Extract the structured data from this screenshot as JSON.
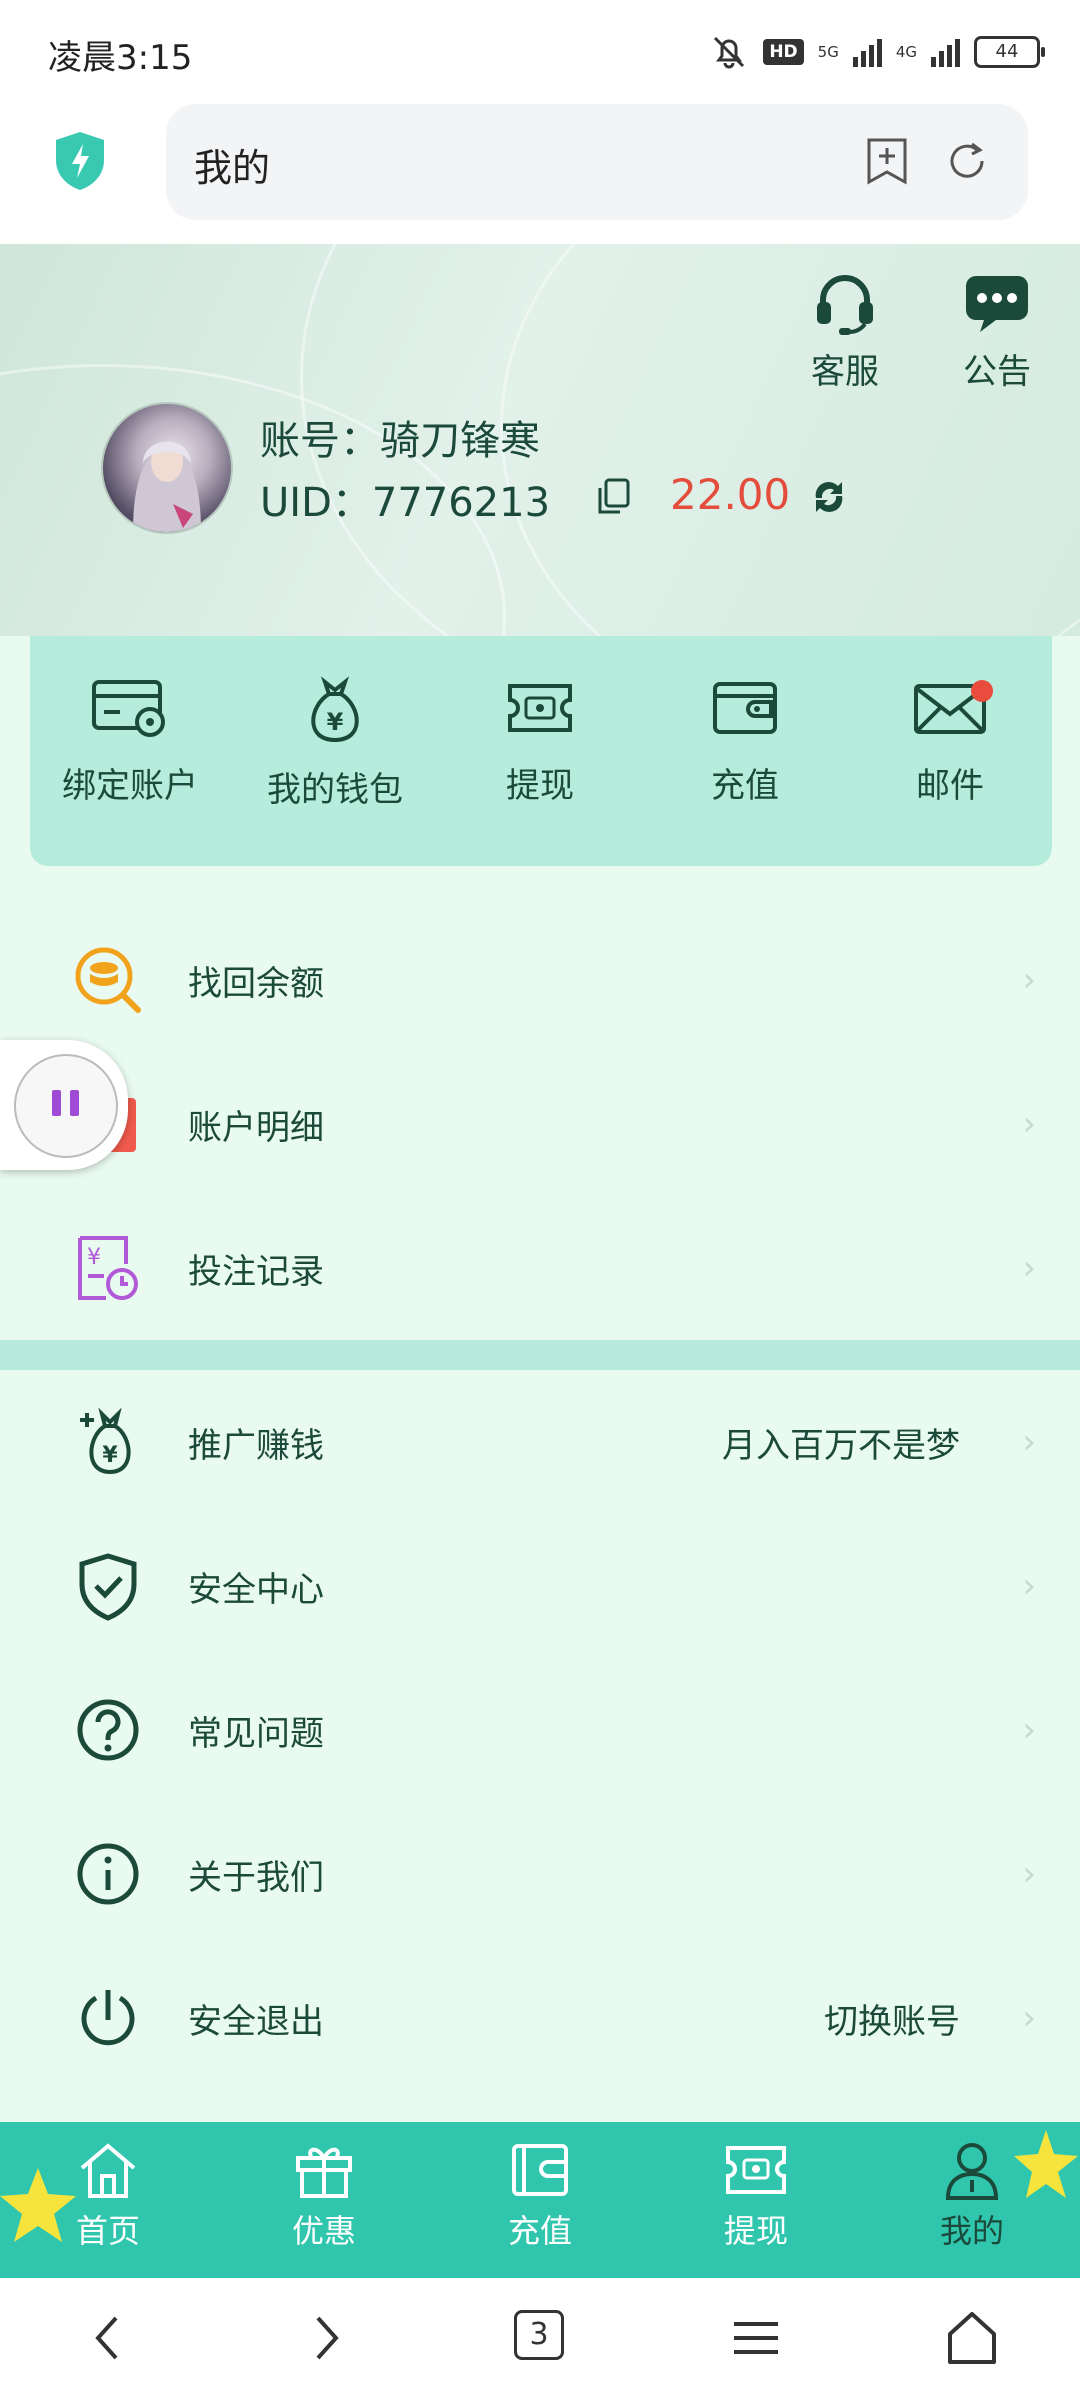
{
  "status_bar": {
    "time": "凌晨3:15",
    "hd": "HD",
    "net1": "5G",
    "net2": "4G",
    "battery": "44"
  },
  "browser": {
    "url_text": "我的"
  },
  "header": {
    "service_label": "客服",
    "notice_label": "公告",
    "account_label": "账号：",
    "account_name": "骑刀锋寒",
    "uid_label": "UID：",
    "uid_value": "7776213",
    "balance": "22.00"
  },
  "quick_actions": [
    {
      "label": "绑定账户",
      "icon": "card-settings-icon"
    },
    {
      "label": "我的钱包",
      "icon": "money-bag-icon"
    },
    {
      "label": "提现",
      "icon": "cash-withdraw-icon"
    },
    {
      "label": "充值",
      "icon": "wallet-icon"
    },
    {
      "label": "邮件",
      "icon": "mail-icon",
      "badge": true
    }
  ],
  "menu_group1": [
    {
      "label": "找回余额",
      "icon": "coin-search-icon"
    },
    {
      "label": "账户明细",
      "icon": "account-detail-icon"
    },
    {
      "label": "投注记录",
      "icon": "bet-record-icon"
    }
  ],
  "menu_group2": [
    {
      "label": "推广赚钱",
      "value": "月入百万不是梦",
      "icon": "promo-money-icon"
    },
    {
      "label": "安全中心",
      "value": "",
      "icon": "shield-check-icon"
    },
    {
      "label": "常见问题",
      "value": "",
      "icon": "question-icon"
    },
    {
      "label": "关于我们",
      "value": "",
      "icon": "info-icon"
    },
    {
      "label": "安全退出",
      "value": "切换账号",
      "icon": "power-icon"
    }
  ],
  "tabs": [
    {
      "label": "首页",
      "icon": "home-icon"
    },
    {
      "label": "优惠",
      "icon": "gift-icon"
    },
    {
      "label": "充值",
      "icon": "wallet-icon"
    },
    {
      "label": "提现",
      "icon": "cash-withdraw-icon"
    },
    {
      "label": "我的",
      "icon": "user-icon",
      "active": true
    }
  ],
  "nav": {
    "tab_count": "3"
  },
  "colors": {
    "accent": "#2fc6ad",
    "panel": "#b5ecdc",
    "background": "#e9faf1",
    "balance": "#e44c3c",
    "icon": "#1c4a3a"
  }
}
